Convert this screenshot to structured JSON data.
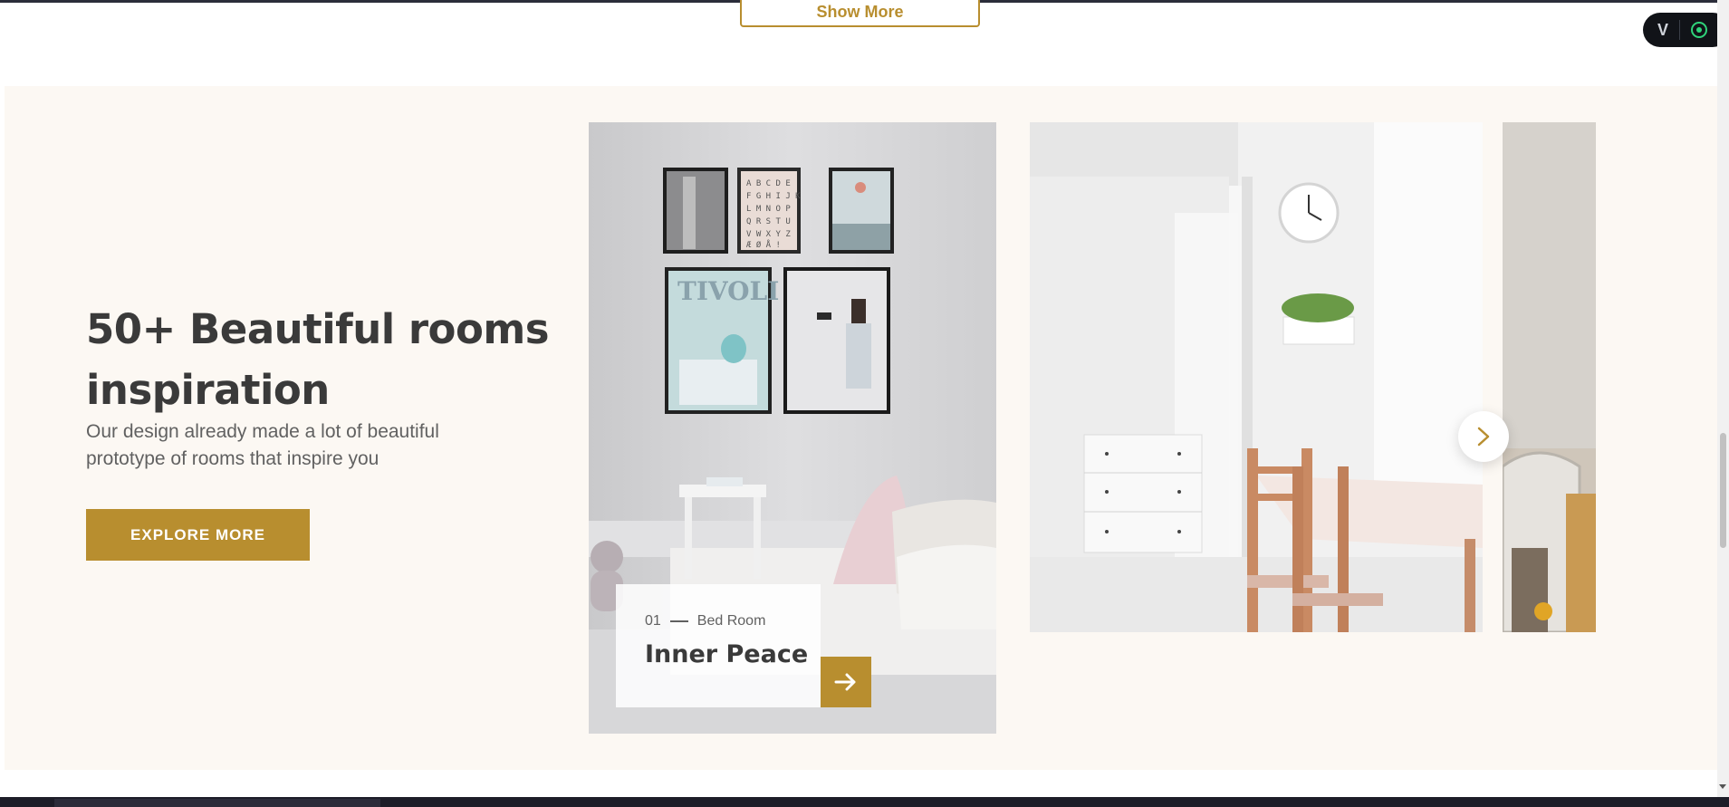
{
  "top": {
    "show_more_label": "Show More"
  },
  "devtools": {
    "logo_glyph": "V"
  },
  "inspiration": {
    "headline": "50+ Beautiful rooms inspiration",
    "description": "Our design already made a lot of beautiful prototype of rooms that inspire you",
    "cta_label": "EXPLORE MORE"
  },
  "slider": {
    "active_card": {
      "index": "01",
      "category": "Bed Room",
      "title": "Inner Peace"
    },
    "next_icon": "chevron-right-icon",
    "card_arrow_icon": "arrow-right-icon"
  },
  "colors": {
    "accent": "#b88e2f",
    "section_bg": "#fcf8f3",
    "heading": "#3a3a3a",
    "body_text": "#616161"
  }
}
